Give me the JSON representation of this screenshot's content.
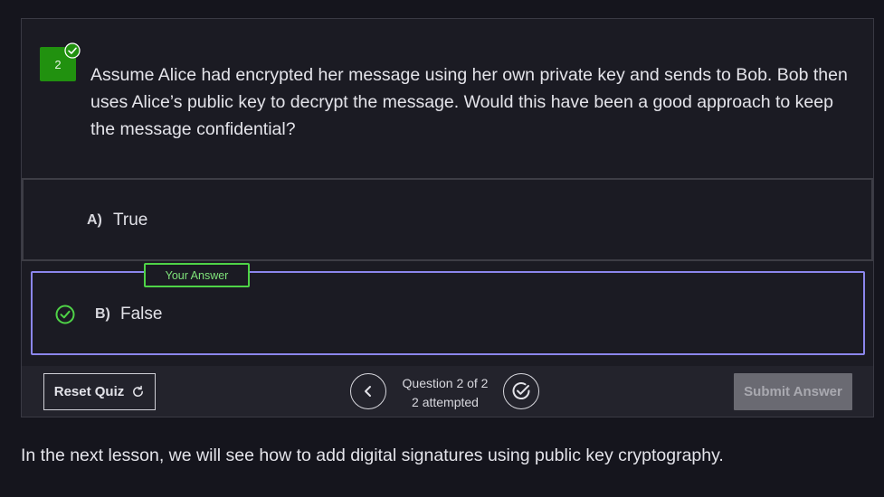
{
  "quiz": {
    "question_number": "2",
    "question_text": "Assume Alice had encrypted her message using her own private key and sends to Bob. Bob then uses Alice’s public key to decrypt the message. Would this have been a good approach to keep the message confidential?",
    "options": [
      {
        "letter": "A)",
        "text": "True",
        "selected": false
      },
      {
        "letter": "B)",
        "text": "False",
        "selected": true,
        "correct": true
      }
    ],
    "your_answer_label": "Your Answer",
    "footer": {
      "reset_label": "Reset Quiz",
      "question_progress": "Question 2 of 2",
      "attempted": "2 attempted",
      "submit_label": "Submit Answer"
    }
  },
  "after_text": "In the next lesson, we will see how to add digital signatures using public key cryptography.",
  "colors": {
    "background": "#15151d",
    "card": "#1b1b23",
    "green": "#21910f",
    "answer_green": "#4fd347",
    "selected_border": "#8b86ec",
    "submit_disabled": "#6a6a72"
  }
}
